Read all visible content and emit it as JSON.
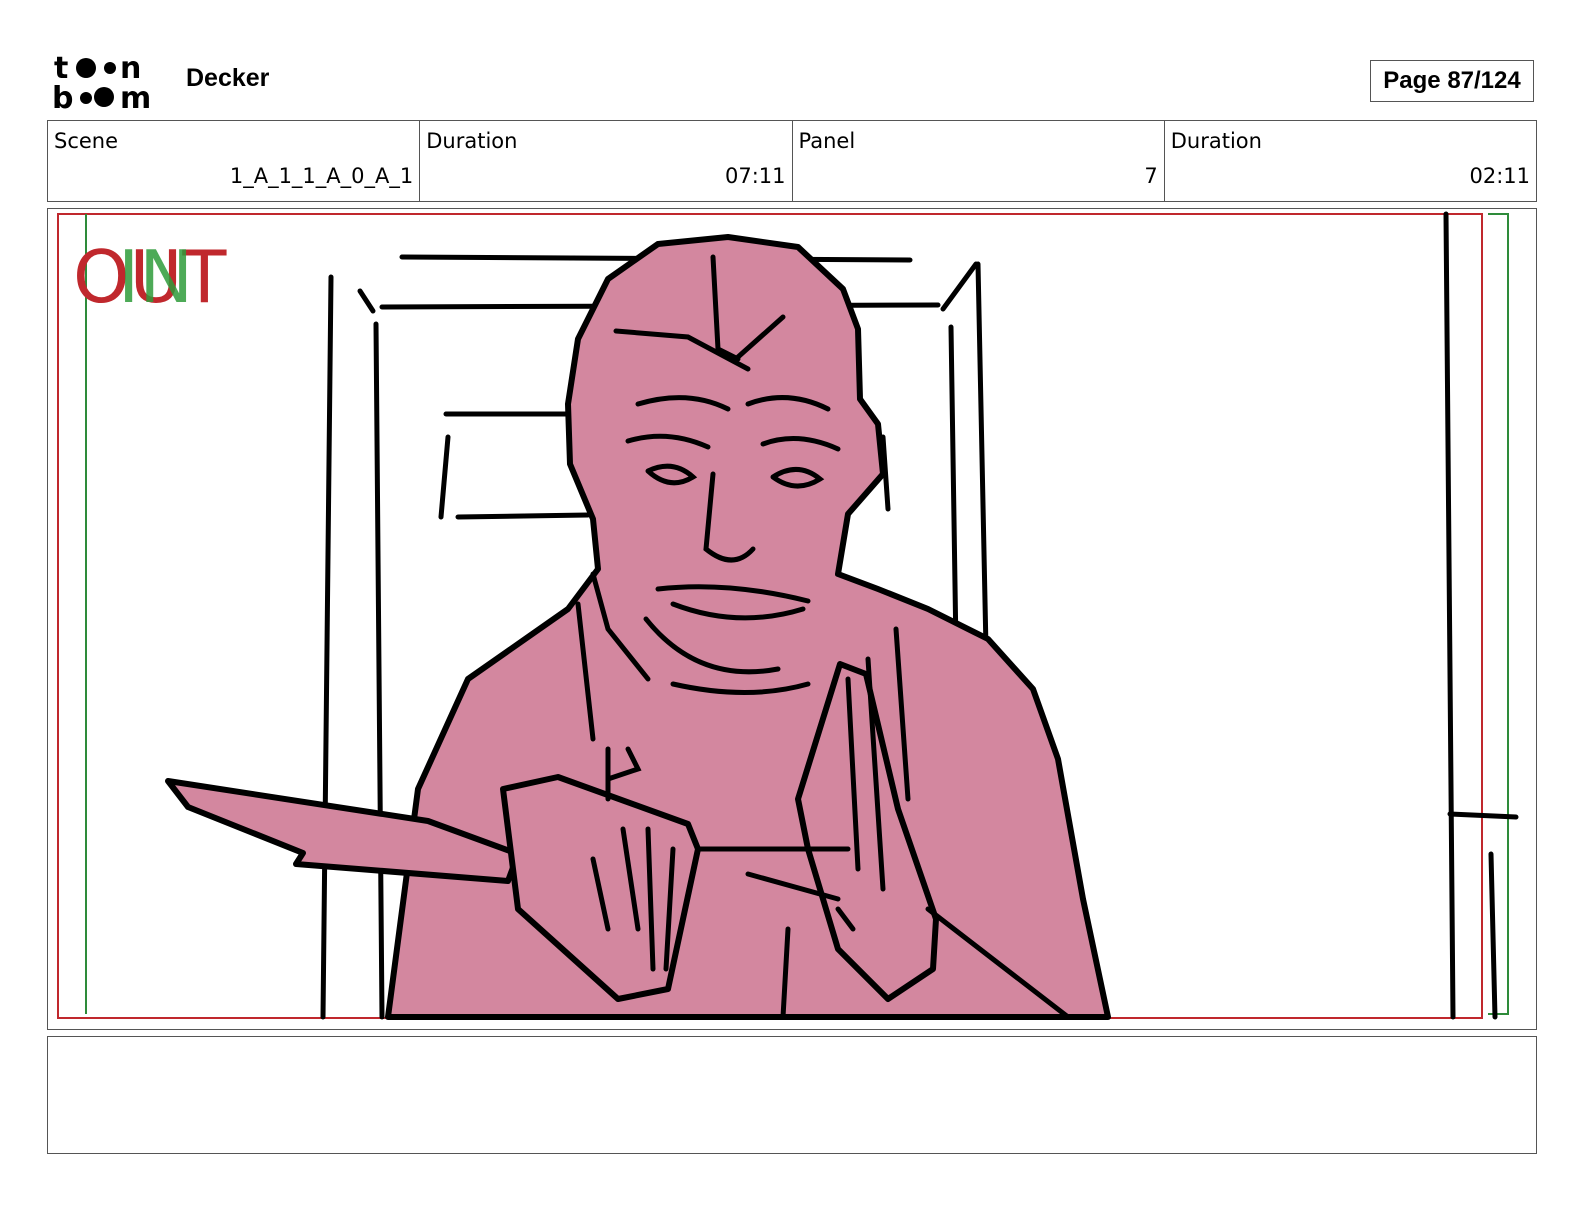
{
  "header": {
    "logo_text": "toon boom",
    "project_title": "Decker",
    "page_label": "Page 87/124"
  },
  "info": {
    "scene_label": "Scene",
    "scene_value": "1_A_1_1_A_0_A_1",
    "scene_duration_label": "Duration",
    "scene_duration_value": "07:11",
    "panel_label": "Panel",
    "panel_value": "7",
    "panel_duration_label": "Duration",
    "panel_duration_value": "02:11"
  },
  "panel": {
    "out_marker": "OUT",
    "in_marker": "IN",
    "colors": {
      "fill": "#d3879f",
      "ink": "#000000",
      "safe_red": "#c0282d",
      "safe_green": "#2e8b3a"
    }
  },
  "notes": {
    "text": ""
  }
}
